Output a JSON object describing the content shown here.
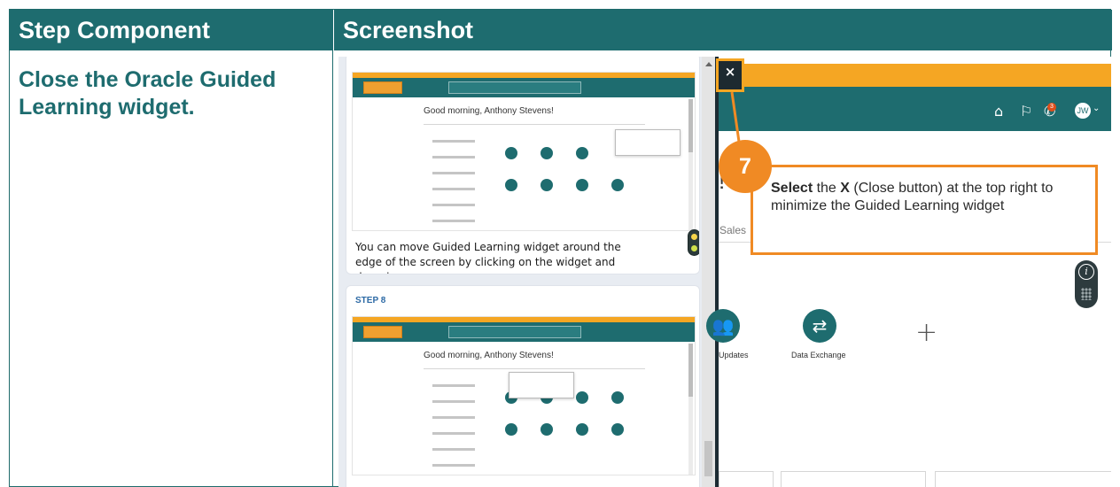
{
  "table": {
    "header_step": "Step Component",
    "header_screenshot": "Screenshot",
    "step_text": "Close the Oracle Guided Learning widget."
  },
  "guided_panel": {
    "card1": {
      "greeting": "Good morning, Anthony Stevens!",
      "instruction": "You can move Guided Learning widget around the edge of the screen by clicking on the widget and dragging."
    },
    "card2": {
      "step_label": "STEP 8",
      "greeting": "Good morning, Anthony Stevens!"
    }
  },
  "app": {
    "notification_count": "3",
    "avatar_initials": "JW",
    "bang": "!",
    "sales_tab": "Sales",
    "tiles": [
      {
        "label": "Updates",
        "icon": "people-update-icon"
      },
      {
        "label": "Data Exchange",
        "icon": "exchange-arrows-icon"
      }
    ],
    "add_symbol": "+"
  },
  "callout": {
    "step_number": "7",
    "select_word": "Select",
    "text_1": " the ",
    "x_word": "X",
    "text_2": " (Close button) at the top right to minimize the Guided Learning widget",
    "close_symbol": "×"
  },
  "colors": {
    "teal": "#1e6c6f",
    "orange": "#f5a623",
    "callout_orange": "#f08a24"
  }
}
